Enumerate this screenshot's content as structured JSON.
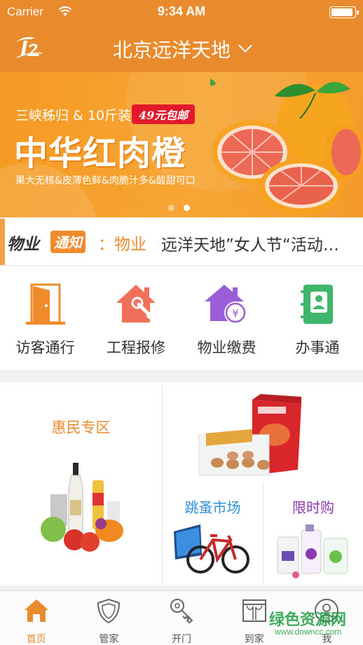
{
  "status_bar": {
    "carrier": "Carrier",
    "time": "9:34 AM"
  },
  "header": {
    "location": "北京远洋天地"
  },
  "banner": {
    "subtitle": "三峡秭归 & 10斤装",
    "price_tag": "49元包邮",
    "title": "中华红肉橙",
    "description": "果大无核&皮薄色鲜&肉脆汁多&酸甜可口",
    "slide_count": 2,
    "active_slide": 2
  },
  "notice": {
    "label_a": "物业",
    "label_b": "通知",
    "category": "：物业",
    "text": "远洋天地”女人节“活动…"
  },
  "services": [
    {
      "label": "访客通行",
      "icon": "door-icon"
    },
    {
      "label": "工程报修",
      "icon": "house-repair-icon"
    },
    {
      "label": "物业缴费",
      "icon": "house-payment-icon"
    },
    {
      "label": "办事通",
      "icon": "contacts-book-icon"
    }
  ],
  "promo": {
    "huimin": "惠民专区",
    "tiaozao": "跳蚤市场",
    "xianshi": "限时购"
  },
  "tabs": [
    {
      "label": "首页",
      "icon": "home-icon",
      "active": true
    },
    {
      "label": "管家",
      "icon": "shield-icon",
      "active": false
    },
    {
      "label": "开门",
      "icon": "key-icon",
      "active": false
    },
    {
      "label": "到家",
      "icon": "storefront-icon",
      "active": false
    },
    {
      "label": "我",
      "icon": "person-icon",
      "active": false
    }
  ],
  "watermark": {
    "text": "绿色资源网",
    "url_text": "www.downcc.com"
  },
  "colors": {
    "accent": "#e98a2d",
    "blue": "#2d8fd8",
    "purple": "#8a3ab0",
    "green": "#3fb66b",
    "red": "#f0705a"
  }
}
